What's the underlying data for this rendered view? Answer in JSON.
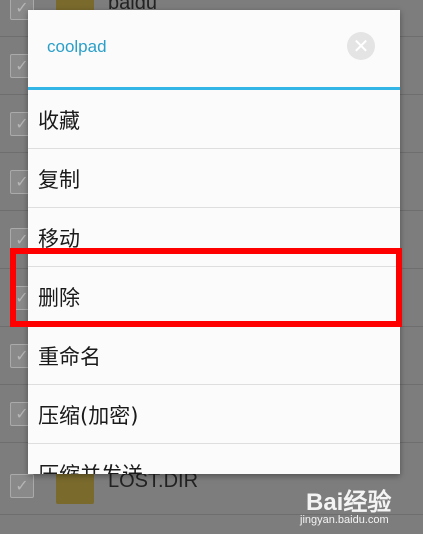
{
  "background_list": {
    "items": [
      {
        "name": "baidu"
      },
      {
        "name": ""
      },
      {
        "name": ""
      },
      {
        "name": ""
      },
      {
        "name": ""
      },
      {
        "name": ""
      },
      {
        "name": ""
      },
      {
        "name": ""
      },
      {
        "name": "LOST.DIR"
      }
    ]
  },
  "dialog": {
    "title": "coolpad",
    "close_icon": "close-icon",
    "menu": [
      {
        "label": "收藏"
      },
      {
        "label": "复制"
      },
      {
        "label": "移动"
      },
      {
        "label": "删除"
      },
      {
        "label": "重命名"
      },
      {
        "label": "压缩(加密)"
      },
      {
        "label": "压缩并发送"
      }
    ]
  },
  "watermark": {
    "logo": "Bai经验",
    "url": "jingyan.baidu.com"
  },
  "colors": {
    "accent": "#33b5e5",
    "highlight": "#ff0000"
  }
}
